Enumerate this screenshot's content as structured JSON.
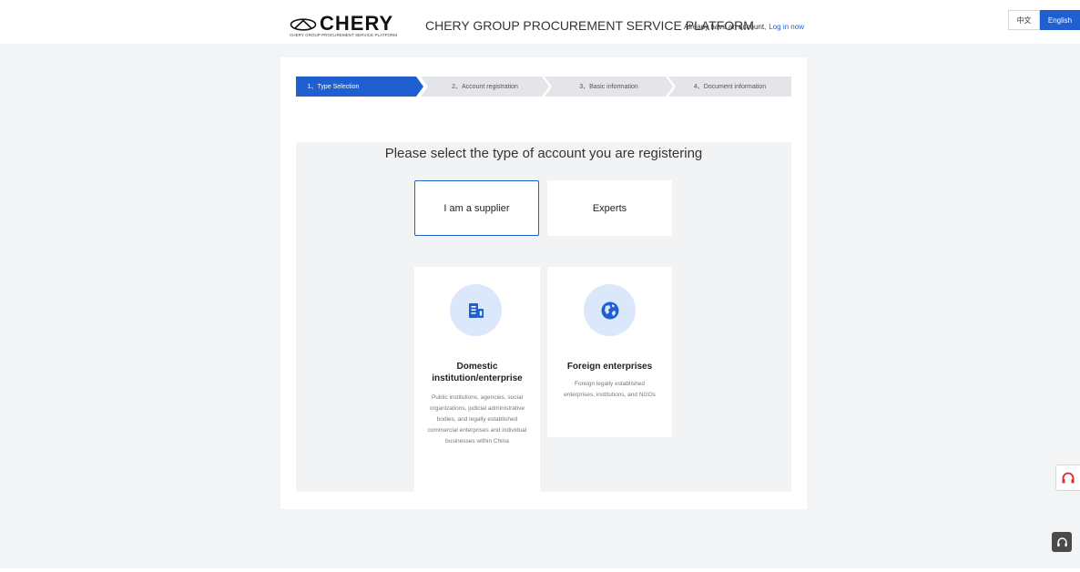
{
  "header": {
    "logo_text": "CHERY",
    "logo_subtitle": "CHERY GROUP PROCUREMENT SERVICE PLATFORM",
    "platform_title": "CHERY GROUP PROCUREMENT SERVICE PLATFORM",
    "login_prompt": "Already have an account,",
    "login_link": "Log in now",
    "lang_cn": "中文",
    "lang_en": "English"
  },
  "steps": [
    {
      "label": "1、Type Selection",
      "active": true
    },
    {
      "label": "2、Account registration",
      "active": false
    },
    {
      "label": "3、Basic information",
      "active": false
    },
    {
      "label": "4、Document information",
      "active": false
    }
  ],
  "selection": {
    "title": "Please select the type of account you are registering",
    "account_types": [
      {
        "label": "I am a supplier",
        "selected": true
      },
      {
        "label": "Experts",
        "selected": false
      }
    ],
    "enterprise_types": [
      {
        "title": "Domestic institution/enterprise",
        "icon": "building-icon",
        "description": "Public institutions, agencies, social organizations, judicial administrative bodies, and legally established commercial enterprises and individual businesses within China"
      },
      {
        "title": "Foreign enterprises",
        "icon": "globe-icon",
        "description": "Foreign legally established enterprises, institutions, and NGOs"
      }
    ]
  },
  "colors": {
    "primary": "#1f5fcf",
    "support_icon": "#e02828"
  },
  "side_icons": [
    "headset-icon",
    "headset-icon"
  ]
}
